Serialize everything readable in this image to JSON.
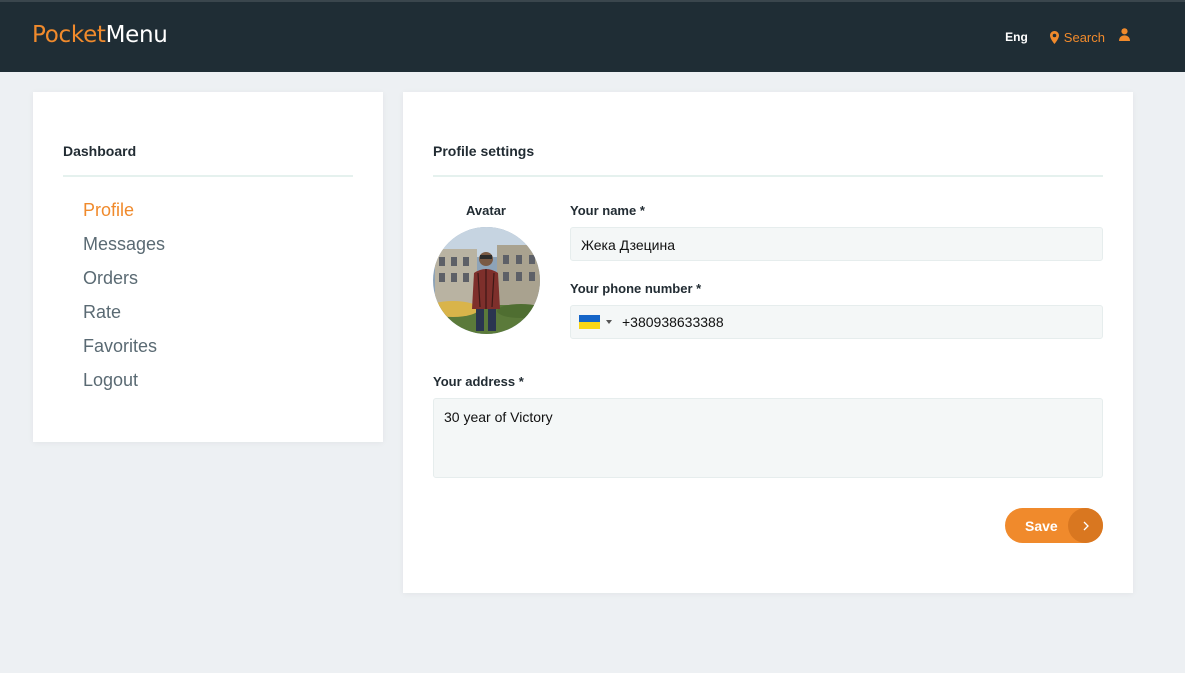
{
  "header": {
    "logo_part1": "Pocket",
    "logo_part2": "Menu",
    "language": "Eng",
    "search_label": "Search"
  },
  "sidebar": {
    "title": "Dashboard",
    "items": [
      {
        "label": "Profile",
        "active": true
      },
      {
        "label": "Messages"
      },
      {
        "label": "Orders"
      },
      {
        "label": "Rate"
      },
      {
        "label": "Favorites"
      },
      {
        "label": "Logout"
      }
    ]
  },
  "profile": {
    "title": "Profile settings",
    "avatar_label": "Avatar",
    "name_label": "Your name *",
    "name_value": "Жека Дзецина",
    "phone_label": "Your phone number *",
    "phone_value": "+380938633388",
    "address_label": "Your address *",
    "address_value": "30 year of Victory",
    "save_label": "Save"
  },
  "colors": {
    "accent": "#f08a2c",
    "header_bg": "#1f2d35",
    "page_bg": "#edf0f3"
  },
  "icons": [
    "map-marker-icon",
    "user-icon",
    "chevron-right-icon",
    "ukraine-flag-icon"
  ]
}
